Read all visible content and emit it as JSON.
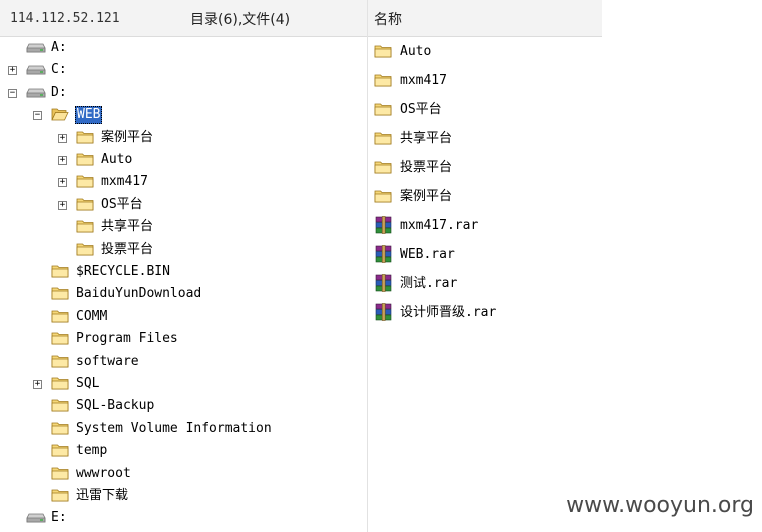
{
  "header": {
    "ip": "114.112.52.121",
    "count": "目录(6),文件(4)",
    "name_column": "名称"
  },
  "tree": {
    "drives": [
      {
        "label": "A:",
        "expander": ""
      },
      {
        "label": "C:",
        "expander": "+"
      },
      {
        "label": "D:",
        "expander": "-"
      },
      {
        "label": "E:",
        "expander": ""
      }
    ],
    "web": {
      "label": "WEB",
      "expander": "-"
    },
    "web_children": [
      {
        "label": "案例平台",
        "expander": "+"
      },
      {
        "label": "Auto",
        "expander": "+"
      },
      {
        "label": "mxm417",
        "expander": "+"
      },
      {
        "label": "OS平台",
        "expander": "+"
      },
      {
        "label": "共享平台",
        "expander": ""
      },
      {
        "label": "投票平台",
        "expander": ""
      }
    ],
    "d_children": [
      {
        "label": "$RECYCLE.BIN",
        "expander": ""
      },
      {
        "label": "BaiduYunDownload",
        "expander": ""
      },
      {
        "label": "COMM",
        "expander": ""
      },
      {
        "label": "Program Files",
        "expander": ""
      },
      {
        "label": "software",
        "expander": ""
      },
      {
        "label": "SQL",
        "expander": "+"
      },
      {
        "label": "SQL-Backup",
        "expander": ""
      },
      {
        "label": "System Volume Information",
        "expander": ""
      },
      {
        "label": "temp",
        "expander": ""
      },
      {
        "label": "wwwroot",
        "expander": ""
      },
      {
        "label": "迅雷下载",
        "expander": ""
      }
    ]
  },
  "files": [
    {
      "name": "Auto",
      "type": "folder"
    },
    {
      "name": "mxm417",
      "type": "folder"
    },
    {
      "name": "OS平台",
      "type": "folder"
    },
    {
      "name": "共享平台",
      "type": "folder"
    },
    {
      "name": "投票平台",
      "type": "folder"
    },
    {
      "name": "案例平台",
      "type": "folder"
    },
    {
      "name": "mxm417.rar",
      "type": "archive"
    },
    {
      "name": "WEB.rar",
      "type": "archive"
    },
    {
      "name": "测试.rar",
      "type": "archive"
    },
    {
      "name": "设计师晋级.rar",
      "type": "archive"
    }
  ],
  "watermark": "www.wooyun.org"
}
